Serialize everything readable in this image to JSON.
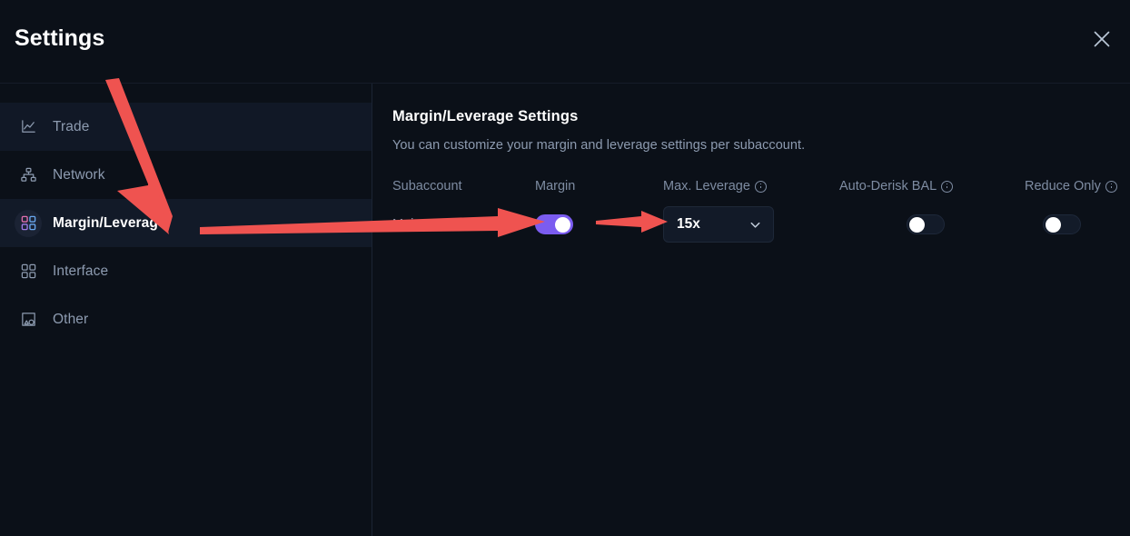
{
  "header": {
    "title": "Settings",
    "close_icon": "close-icon"
  },
  "sidebar": {
    "items": [
      {
        "label": "Trade",
        "icon": "chart-line-icon",
        "state": "shaded"
      },
      {
        "label": "Network",
        "icon": "network-tree-icon",
        "state": "normal"
      },
      {
        "label": "Margin/Leverage",
        "icon": "grid-blocks-icon",
        "state": "active"
      },
      {
        "label": "Interface",
        "icon": "grid-blocks-icon",
        "state": "normal"
      },
      {
        "label": "Other",
        "icon": "shapes-icon",
        "state": "normal"
      }
    ]
  },
  "main": {
    "title": "Margin/Leverage Settings",
    "subtitle": "You can customize your margin and leverage settings per subaccount.",
    "table": {
      "columns": [
        {
          "label": "Subaccount",
          "info": false
        },
        {
          "label": "Margin",
          "info": false
        },
        {
          "label": "Max. Leverage",
          "info": true
        },
        {
          "label": "Auto-Derisk BAL",
          "info": true
        },
        {
          "label": "Reduce Only",
          "info": true
        }
      ],
      "rows": [
        {
          "subaccount": "Main Account",
          "margin_enabled": true,
          "max_leverage": "15x",
          "auto_derisk_enabled": false,
          "reduce_only_enabled": false
        }
      ]
    }
  },
  "annotations": {
    "accent_color": "#ef5350",
    "arrows": [
      {
        "name": "arrow-to-margin-leverage-tab"
      },
      {
        "name": "arrow-to-margin-toggle"
      },
      {
        "name": "arrow-to-leverage-dropdown"
      }
    ]
  },
  "colors": {
    "background": "#0b1018",
    "panel": "#0b1018",
    "toggle_on": "#7b5cf0",
    "text_primary": "#ffffff",
    "text_muted": "#8d9bb0",
    "annotation_red": "#ef5350"
  }
}
